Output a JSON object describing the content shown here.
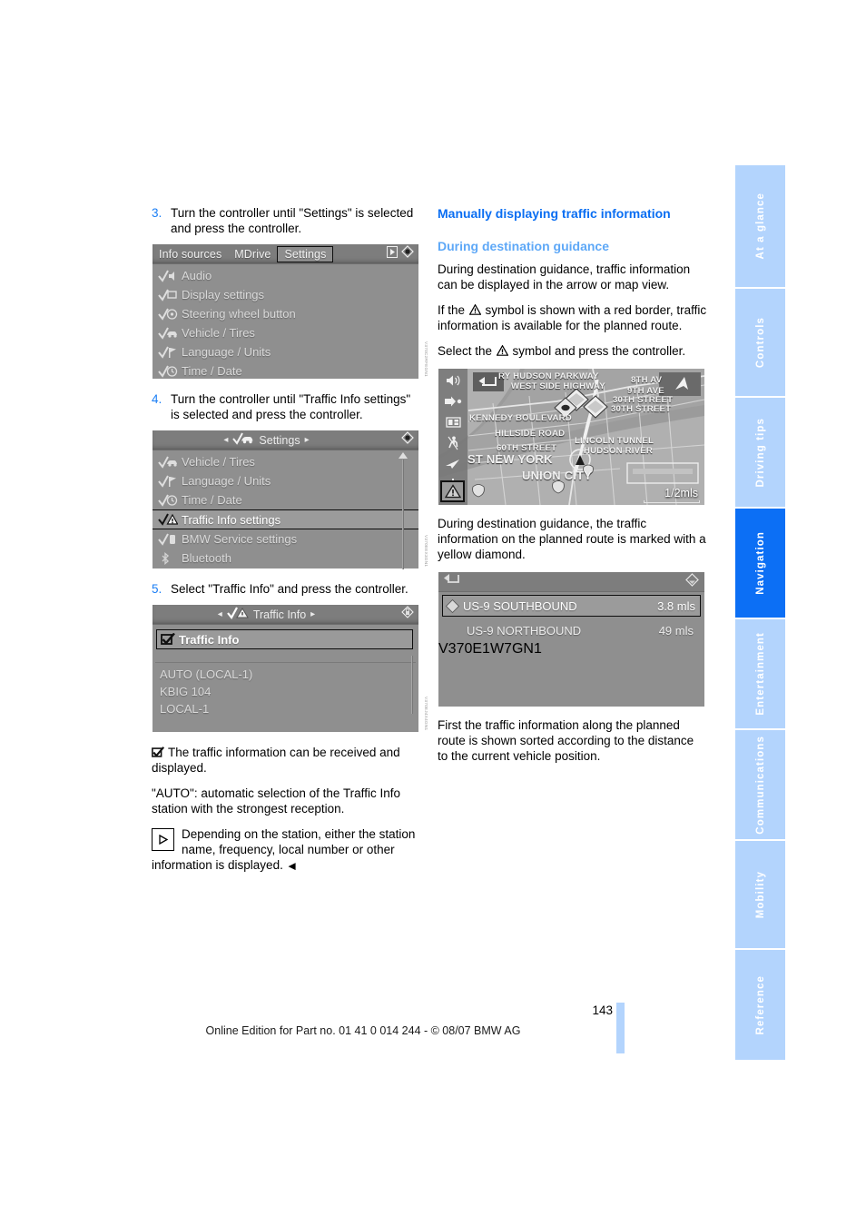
{
  "page": {
    "number": "143",
    "footer": "Online Edition for Part no. 01 41 0 014 244 - © 08/07 BMW AG"
  },
  "left_column": {
    "steps": [
      {
        "num": "3.",
        "text": "Turn the controller until \"Settings\" is selected and press the controller."
      },
      {
        "num": "4.",
        "text": "Turn the controller until \"Traffic Info settings\" is selected and press the controller."
      },
      {
        "num": "5.",
        "text": "Select \"Traffic Info\" and press the controller."
      }
    ],
    "screenshot_settings": {
      "menubar": {
        "tabs": [
          "Info sources",
          "MDrive",
          "Settings"
        ],
        "selected": "Settings"
      },
      "items": [
        {
          "label": "Audio",
          "icon": "check-speaker-icon"
        },
        {
          "label": "Display settings",
          "icon": "check-display-icon"
        },
        {
          "label": "Steering wheel button",
          "icon": "check-steeringwheel-icon"
        },
        {
          "label": "Vehicle / Tires",
          "icon": "check-car-icon"
        },
        {
          "label": "Language / Units",
          "icon": "check-flag-icon"
        },
        {
          "label": "Time / Date",
          "icon": "check-clock-icon"
        }
      ]
    },
    "screenshot_settings_sub": {
      "title": "Settings",
      "items": [
        {
          "label": "Vehicle / Tires",
          "icon": "check-car-icon",
          "selected": false
        },
        {
          "label": "Language / Units",
          "icon": "check-flag-icon",
          "selected": false
        },
        {
          "label": "Time / Date",
          "icon": "check-clock-icon",
          "selected": false
        },
        {
          "label": "Traffic Info settings",
          "icon": "check-warning-icon",
          "selected": true
        },
        {
          "label": "BMW Service settings",
          "icon": "check-service-icon",
          "selected": false
        },
        {
          "label": "Bluetooth",
          "icon": "bluetooth-icon",
          "selected": false
        }
      ]
    },
    "screenshot_traffic_info": {
      "title": "Traffic Info",
      "checkbox_item": {
        "label": "Traffic Info",
        "checked": true
      },
      "stations": [
        "AUTO (LOCAL-1)",
        "KBIG 104",
        "LOCAL-1"
      ]
    },
    "notes": [
      {
        "icon": "checkbox-checked-icon",
        "text": "The traffic information can be received and displayed."
      },
      {
        "icon": "",
        "text": "\"AUTO\": automatic selection of the Traffic Info station with the strongest reception."
      },
      {
        "icon": "play-box-icon",
        "text": "Depending on the station, either the station name, frequency, local number or other information is displayed."
      }
    ]
  },
  "right_column": {
    "heading": "Manually displaying traffic information",
    "subheading": "During destination guidance",
    "paragraphs": [
      {
        "id": "p1",
        "text": "During destination guidance, traffic information can be displayed in the arrow or map view."
      },
      {
        "id": "p2_a",
        "text": "If the "
      },
      {
        "id": "p2_b",
        "text": " symbol is shown with a red border, traffic information is available for the planned route."
      },
      {
        "id": "p3_a",
        "text": "Select the "
      },
      {
        "id": "p3_b",
        "text": " symbol and press the controller."
      },
      {
        "id": "p4",
        "text": "During destination guidance, the traffic information on the planned route is marked with a yellow diamond."
      },
      {
        "id": "p5",
        "text": "First the traffic information along the planned route is shown sorted according to the distance to the current vehicle position."
      }
    ],
    "map_screenshot": {
      "scale": "1/2mls",
      "labels": [
        "RY HUDSON PARKWAY",
        "WEST SIDE HIGHWAY",
        "8TH AV",
        "9TH AVE",
        "30TH STREET",
        "30TH STREET",
        "KENNEDY BOULEVARD",
        "HILLSIDE ROAD",
        "60TH STREET",
        "LINCOLN TUNNEL",
        "HUDSON RIVER",
        "ST NEW YORK",
        "UNION CITY"
      ],
      "sidebar_icons": [
        "volume-icon",
        "route-icon",
        "split-screen-icon",
        "pedestrian-icon",
        "arrow-guidance-icon",
        "compass-icon",
        "traffic-warning-icon"
      ],
      "back_icon": "back-arrow-icon",
      "direction_icon": "north-arrow-icon"
    },
    "traffic_list_screenshot": {
      "back_icon": "back-arrow-icon",
      "rows": [
        {
          "name": "US-9 SOUTHBOUND",
          "distance": "3.8 mls",
          "selected": true
        },
        {
          "name": "US-9 NORTHBOUND",
          "distance": "49 mls",
          "selected": false
        }
      ]
    }
  },
  "side_tabs": [
    {
      "label": "At a glance",
      "active": false
    },
    {
      "label": "Controls",
      "active": false
    },
    {
      "label": "Driving tips",
      "active": false
    },
    {
      "label": "Navigation",
      "active": true
    },
    {
      "label": "Entertainment",
      "active": false
    },
    {
      "label": "Communications",
      "active": false
    },
    {
      "label": "Mobility",
      "active": false
    },
    {
      "label": "Reference",
      "active": false
    }
  ],
  "colors": {
    "heading_blue": "#0a6ef2",
    "sub_blue": "#5ea8f7",
    "tab_inactive": "#b3d4fd",
    "tab_active": "#0c6ff5",
    "screen_gray": "#8f8f8f"
  }
}
